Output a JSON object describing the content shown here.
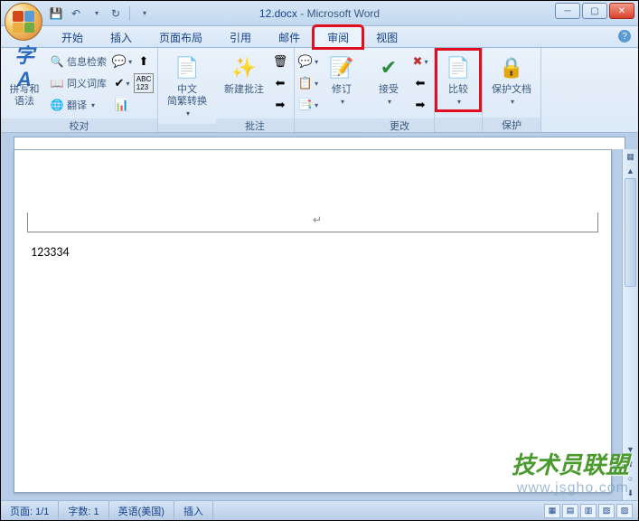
{
  "title": {
    "doc": "12.docx",
    "app": "Microsoft Word"
  },
  "tabs": {
    "start": "开始",
    "insert": "插入",
    "layout": "页面布局",
    "ref": "引用",
    "mail": "邮件",
    "review": "审阅",
    "view": "视图"
  },
  "ribbon": {
    "group_proof": "校对",
    "group_comment": "批注",
    "group_change": "更改",
    "group_protect": "保护",
    "spelling": "拼写和\n语法",
    "research": "信息检索",
    "thesaurus": "同义词库",
    "translate": "翻译",
    "cn_convert": "中文\n简繁转换",
    "new_comment": "新建批注",
    "track": "修订",
    "accept": "接受",
    "compare": "比较",
    "protect": "保护文档"
  },
  "document": {
    "text": "123334"
  },
  "status": {
    "page": "页面: 1/1",
    "words": "字数: 1",
    "lang": "英语(美国)",
    "mode": "插入"
  },
  "watermark": {
    "line1": "技术员联盟",
    "line2": "www.jsgho.com"
  }
}
